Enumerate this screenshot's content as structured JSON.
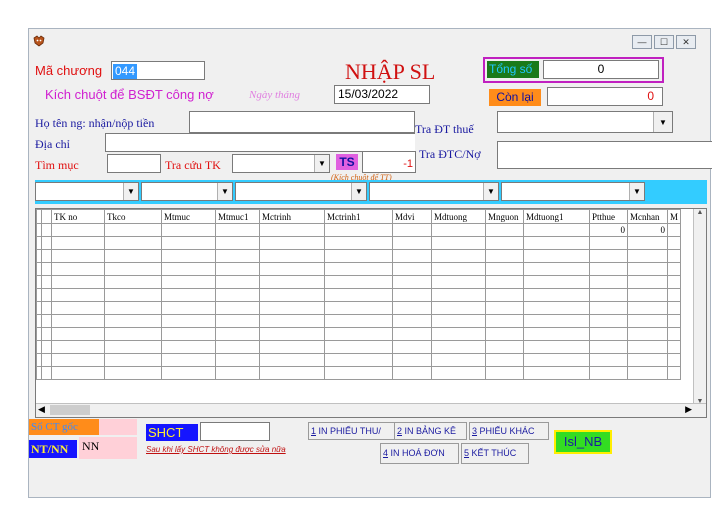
{
  "window": {
    "minimize": "—",
    "maximize": "☐",
    "close": "✕"
  },
  "header": {
    "ma_chuong_label": "Mã chương",
    "ma_chuong_value": "044",
    "title": "NHẬP SL",
    "tong_so_label": "Tổng số",
    "tong_so_value": "0",
    "kich_chuot_label": "Kích chuột để BSĐT công nợ",
    "ngay_thang_label": "Ngày tháng",
    "ngay_thang_value": "15/03/2022",
    "con_lai_label": "Còn lại",
    "con_lai_value": "0"
  },
  "form": {
    "ho_ten_label": "Họ tên ng: nhận/nộp tiền",
    "tra_dt_thue_label": "Tra ĐT thuế",
    "dia_chi_label": "Địa chỉ",
    "tim_muc_label": "Tìm mục",
    "tra_cuu_tk_label": "Tra cứu TK",
    "ts_label": "TS",
    "ts_value": "-1",
    "ts_hint": "(Kích chuột để TT)",
    "tra_dtc_label": "Tra ĐTC/Nợ"
  },
  "grid": {
    "columns": [
      "TK no",
      "Tkco",
      "Mtmuc",
      "Mtmuc1",
      "Mctrinh",
      "Mctrinh1",
      "Mdvi",
      "Mdtuong",
      "Mnguon",
      "Mdtuong1",
      "Ptthue",
      "Mcnhan",
      "M"
    ],
    "first_row": [
      "",
      "",
      "",
      "",
      "",
      "",
      "",
      "",
      "",
      "",
      "0",
      "0",
      ""
    ]
  },
  "footer": {
    "so_ct_goc_label": "Số CT gốc",
    "shct_label": "SHCT",
    "shct_hint": "Sau khi lấy SHCT không được sửa nữa",
    "ntnn_label": "NT/NN",
    "ntnn_value": "NN",
    "btn1_key": "1",
    "btn1_label": " IN PHIẾU THU/",
    "btn2_key": "2",
    "btn2_label": " IN BẢNG KÊ",
    "btn3_key": "3",
    "btn3_label": " PHIẾU KHÁC",
    "btn4_key": "4",
    "btn4_label": " IN HOÁ ĐƠN",
    "btn5_key": "5",
    "btn5_label": " KẾT THÚC",
    "isl_nb_label": "Isl_NB"
  }
}
